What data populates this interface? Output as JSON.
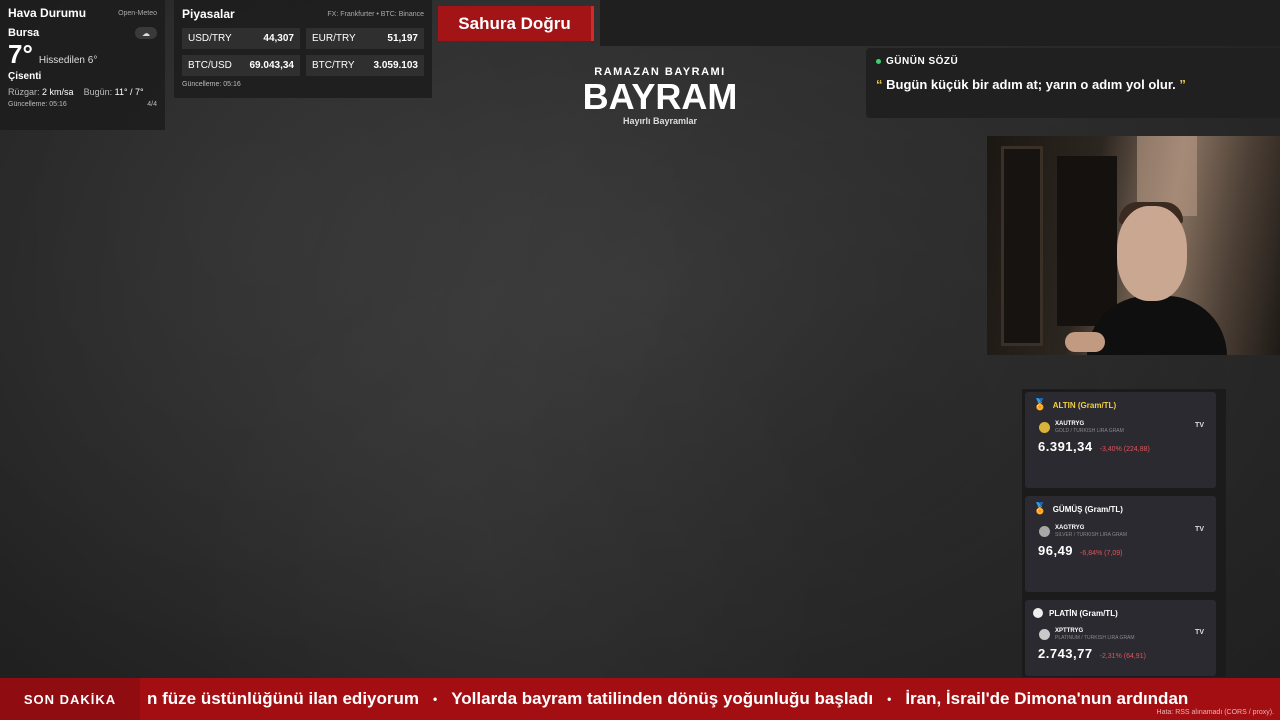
{
  "weather": {
    "title": "Hava Durumu",
    "source": "Open-Meteo",
    "city": "Bursa",
    "icon": "cloud-icon",
    "temp": "7°",
    "feels": "Hissedilen 6°",
    "condition": "Çisenti",
    "wind_label": "Rüzgar:",
    "wind_value": "2 km/sa",
    "today_label": "Bugün:",
    "today_value": "11° / 7°",
    "updated": "Güncelleme: 05:16",
    "page": "4/4"
  },
  "markets": {
    "title": "Piyasalar",
    "source": "FX: Frankfurter • BTC: Binance",
    "items": [
      {
        "label": "USD/TRY",
        "value": "44,307"
      },
      {
        "label": "EUR/TRY",
        "value": "51,197"
      },
      {
        "label": "BTC/USD",
        "value": "69.043,34"
      },
      {
        "label": "BTC/TRY",
        "value": "3.059.103"
      }
    ],
    "updated": "Güncelleme: 05:16"
  },
  "countdown": {
    "label": "Sahura Doğru"
  },
  "banner": {
    "subtitle": "RAMAZAN BAYRAMI",
    "title": "BAYRAM",
    "wish": "Hayırlı Bayramlar"
  },
  "quote": {
    "label": "GÜNÜN SÖZÜ",
    "open_mark": "“",
    "text": "Bugün küçük bir adım at; yarın o adım yol olur.",
    "close_mark": "”"
  },
  "metals": [
    {
      "title": "ALTIN (Gram/TL)",
      "icon": "gold-medal-icon",
      "symbol": "XAUTRYG",
      "description": "GOLD / TURKISH LIRA GRAM",
      "price": "6.391,34",
      "change": "-3,40% (224,88)",
      "coin_color": "#d8b43a",
      "title_color": "#f0d141"
    },
    {
      "title": "GÜMÜŞ (Gram/TL)",
      "icon": "silver-medal-icon",
      "symbol": "XAGTRYG",
      "description": "SILVER / TURKISH LIRA GRAM",
      "price": "96,49",
      "change": "-6,84% (7,09)",
      "coin_color": "#a7a7a7",
      "title_color": "#ffffff"
    },
    {
      "title": "PLATİN (Gram/TL)",
      "icon": "platinum-circle-icon",
      "symbol": "XPTTRYG",
      "description": "PLATINUM / TURKISH LIRA GRAM",
      "price": "2.743,77",
      "change": "-2,31% (64,91)",
      "coin_color": "#c9c9c9",
      "title_color": "#ffffff"
    }
  ],
  "tv_badge": "TV",
  "ticker": {
    "label": "SON DAKİKA",
    "items": [
      "n füze üstünlüğünü ilan ediyorum",
      "Yollarda bayram tatilinden dönüş yoğunluğu başladı",
      "İran, İsrail'de Dimona'nun ardından"
    ],
    "separator": "•",
    "error": "Hata: RSS alınamadı (CORS / proxy)."
  },
  "colors": {
    "accent_red": "#a30e12",
    "gold": "#f0d141",
    "negative": "#e0545a",
    "live_dot": "#3bd16f"
  }
}
